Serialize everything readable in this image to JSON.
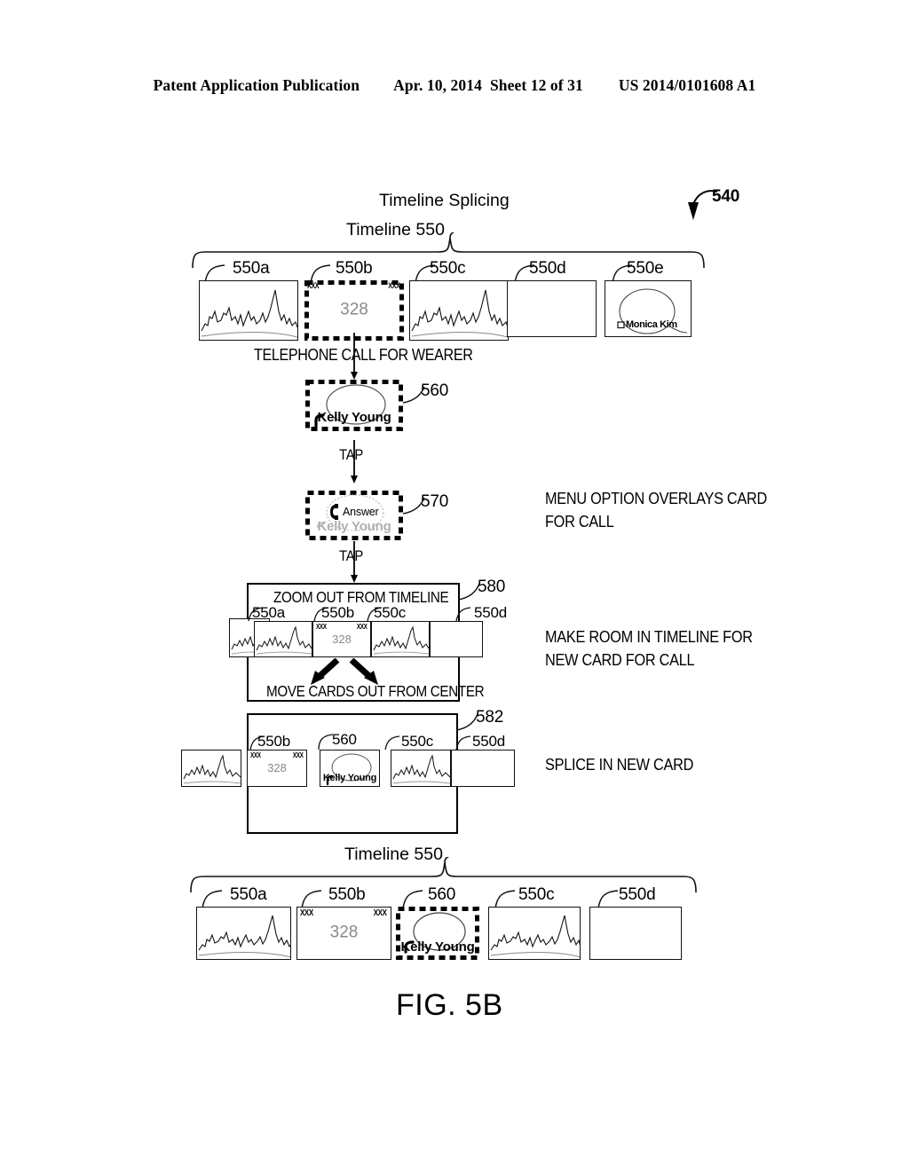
{
  "header": {
    "publication": "Patent Application Publication",
    "date": "Apr. 10, 2014",
    "sheet": "Sheet 12 of 31",
    "number": "US 2014/0101608 A1"
  },
  "figure": {
    "title": "Timeline Splicing",
    "ref_540": "540",
    "caption": "FIG. 5B"
  },
  "timeline_top": {
    "brace_label": "Timeline 550",
    "cards": [
      {
        "ref": "550a",
        "kind": "skyline",
        "text": ""
      },
      {
        "ref": "550b",
        "kind": "number",
        "text": "328",
        "corner_left": "XXX",
        "corner_right": "XXX",
        "selected": true
      },
      {
        "ref": "550c",
        "kind": "skyline",
        "text": ""
      },
      {
        "ref": "550d",
        "kind": "blank",
        "text": ""
      },
      {
        "ref": "550e",
        "kind": "contact",
        "text": "Monica Kim"
      }
    ]
  },
  "flow": {
    "step_call_label": "TELEPHONE CALL FOR WEARER",
    "card_560": {
      "ref": "560",
      "name": "Kelly Young",
      "selected": true
    },
    "tap_1": "TAP",
    "card_570": {
      "ref": "570",
      "menu_label": "Answer",
      "name": "Kelly Young",
      "selected": true
    },
    "tap_2": "TAP",
    "note_570": "MENU OPTION OVERLAYS CARD FOR CALL",
    "note_570_lines": [
      "MENU OPTION OVERLAYS CARD",
      "FOR CALL"
    ]
  },
  "box_580": {
    "ref": "580",
    "title": "ZOOM OUT FROM TIMELINE",
    "footer": "MOVE CARDS OUT FROM CENTER",
    "note_lines": [
      "MAKE ROOM IN TIMELINE FOR",
      "NEW CARD FOR CALL"
    ],
    "cards": [
      {
        "ref": "",
        "kind": "skyline"
      },
      {
        "ref": "550a",
        "kind": "skyline"
      },
      {
        "ref": "550b",
        "kind": "number",
        "text": "328",
        "corner_left": "XXX",
        "corner_right": "XXX"
      },
      {
        "ref": "550c",
        "kind": "skyline"
      },
      {
        "ref": "550d",
        "kind": "blank"
      }
    ]
  },
  "box_582": {
    "ref": "582",
    "note": "SPLICE IN NEW CARD",
    "cards": [
      {
        "ref": "",
        "kind": "skyline"
      },
      {
        "ref": "550b",
        "kind": "number",
        "text": "328",
        "corner_left": "XXX",
        "corner_right": "XXX"
      },
      {
        "ref": "560",
        "kind": "contact",
        "text": "Kelly Young"
      },
      {
        "ref": "550c",
        "kind": "skyline"
      },
      {
        "ref": "550d",
        "kind": "blank"
      }
    ]
  },
  "timeline_bottom": {
    "brace_label": "Timeline 550",
    "cards": [
      {
        "ref": "550a",
        "kind": "skyline"
      },
      {
        "ref": "550b",
        "kind": "number",
        "text": "328",
        "corner_left": "XXX",
        "corner_right": "XXX"
      },
      {
        "ref": "560",
        "kind": "contact",
        "text": "Kelly Young",
        "selected": true
      },
      {
        "ref": "550c",
        "kind": "skyline"
      },
      {
        "ref": "550d",
        "kind": "blank"
      }
    ]
  }
}
